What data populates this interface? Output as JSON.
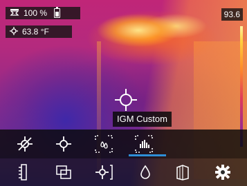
{
  "status": {
    "battery_percent": "100 %",
    "spot_temp": "63.8 °F",
    "max_temp": "93.6"
  },
  "crosshair": {
    "label": "IGM Custom"
  },
  "toolbar_top": {
    "items": [
      {
        "icon": "crosshair-off-icon"
      },
      {
        "icon": "crosshair-icon"
      },
      {
        "icon": "moisture-frame-icon"
      },
      {
        "icon": "igm-custom-icon",
        "selected": true
      }
    ]
  },
  "toolbar_bottom": {
    "items": [
      {
        "icon": "palette-scale-icon"
      },
      {
        "icon": "picture-in-picture-icon"
      },
      {
        "icon": "spot-measure-icon"
      },
      {
        "icon": "drop-icon"
      },
      {
        "icon": "emissivity-icon"
      },
      {
        "icon": "gear-icon"
      }
    ]
  },
  "colors": {
    "selected_accent": "#2e8fd8"
  }
}
